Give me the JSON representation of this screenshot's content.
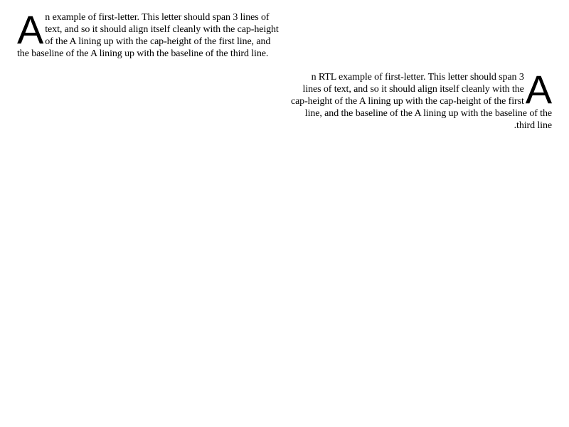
{
  "ltr_example": {
    "drop_letter": "A",
    "lines": [
      "n example of first-letter. This letter should span 3 lines of",
      "text, and so it should align itself cleanly with the cap-height",
      "of the A lining up with the cap-height of the first line, and",
      "the baseline of the A lining up with the baseline of the third line."
    ]
  },
  "rtl_example": {
    "drop_letter": "A",
    "lines": [
      "n RTL example of first-letter. This letter should span 3",
      "lines of text, and so it should align itself cleanly with the",
      "cap-height of the A lining up with the cap-height of the first",
      "line, and the baseline of the A lining up with the baseline of the",
      ".third line"
    ]
  }
}
